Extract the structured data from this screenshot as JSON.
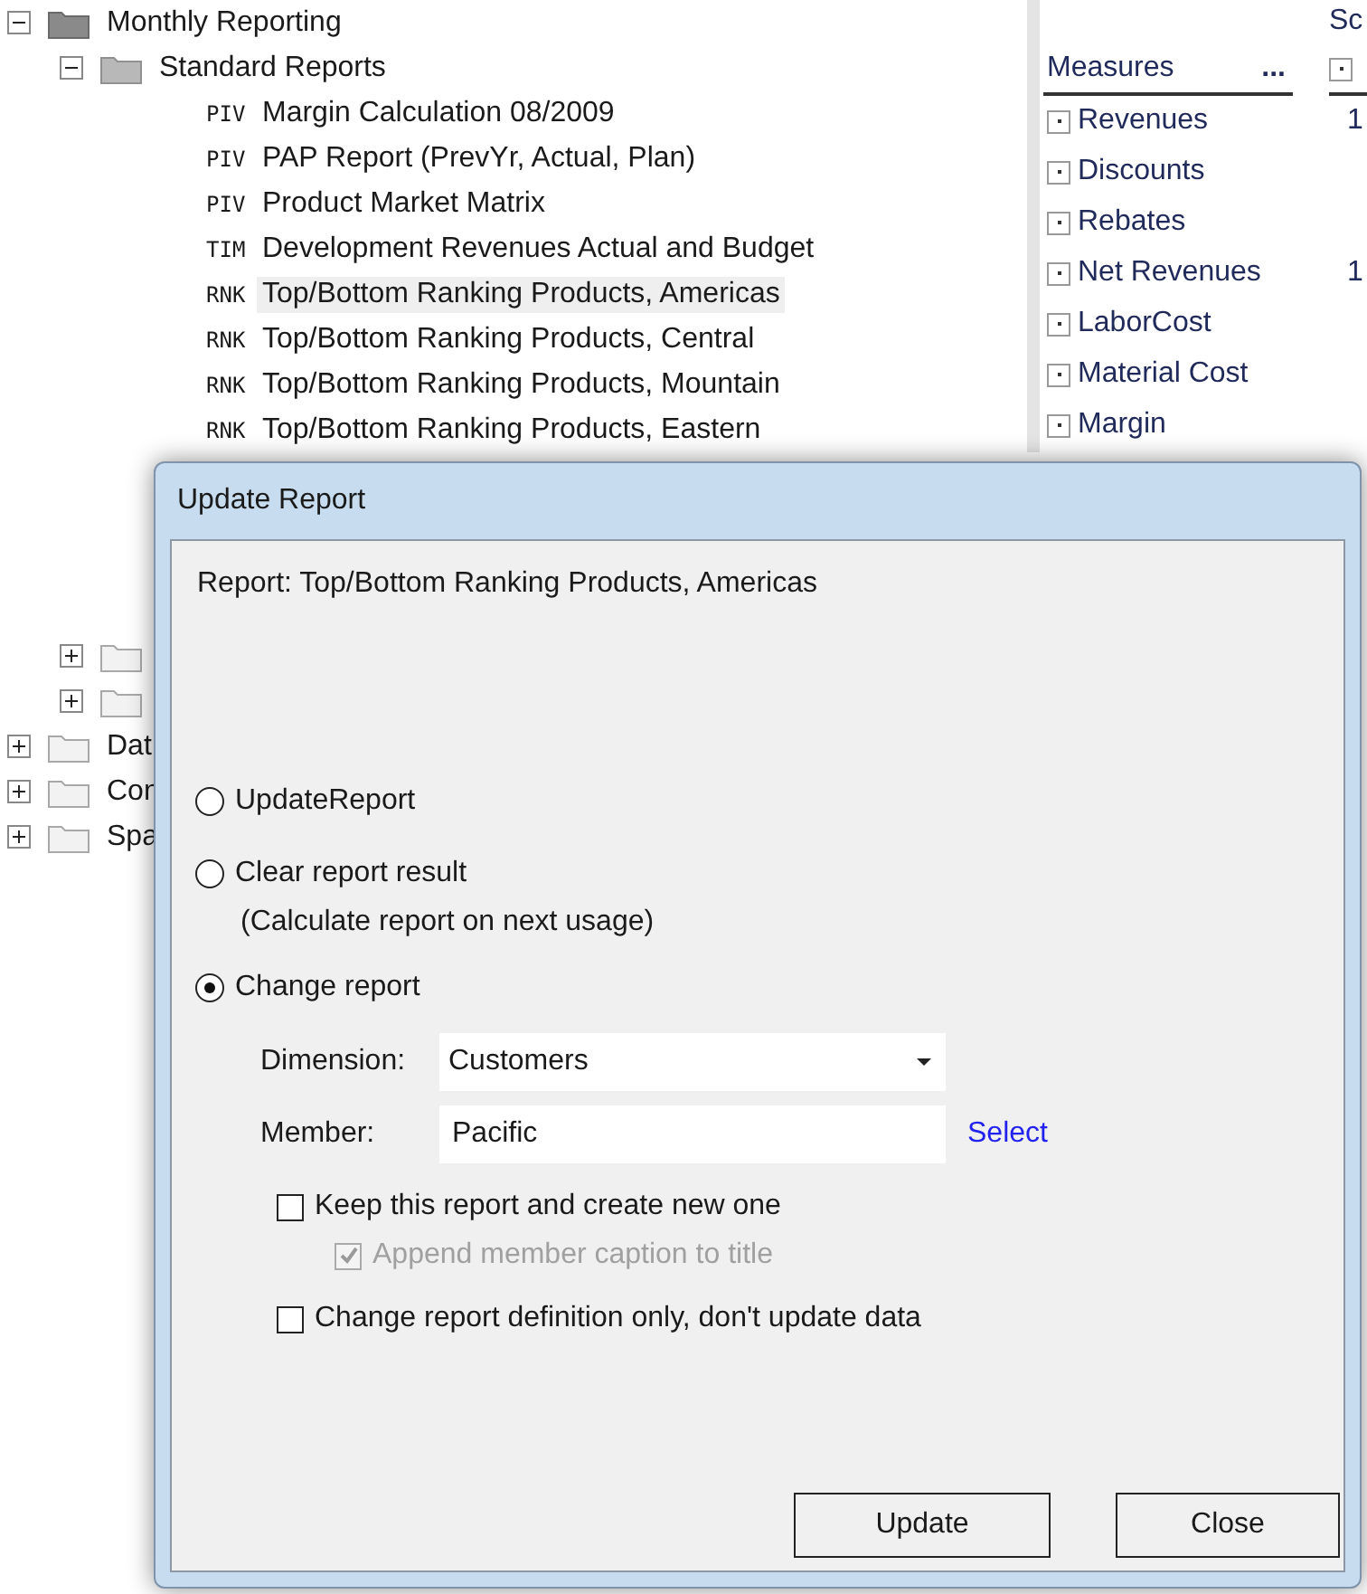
{
  "tree": [
    {
      "label": "Monthly Reporting",
      "kind": "folder",
      "expanded": true,
      "children": [
        {
          "label": "Standard Reports",
          "kind": "folder",
          "expanded": true,
          "children": [
            {
              "code": "PIV",
              "label": "Margin Calculation 08/2009",
              "kind": "report",
              "selected": false
            },
            {
              "code": "PIV",
              "label": "PAP Report (PrevYr, Actual, Plan)",
              "kind": "report",
              "selected": false
            },
            {
              "code": "PIV",
              "label": "Product Market Matrix",
              "kind": "report",
              "selected": false
            },
            {
              "code": "TIM",
              "label": "Development Revenues Actual and Budget",
              "kind": "report",
              "selected": false
            },
            {
              "code": "RNK",
              "label": "Top/Bottom Ranking Products, Americas",
              "kind": "report",
              "selected": true
            },
            {
              "code": "RNK",
              "label": "Top/Bottom Ranking Products, Central",
              "kind": "report",
              "selected": false
            },
            {
              "code": "RNK",
              "label": "Top/Bottom Ranking Products, Mountain",
              "kind": "report",
              "selected": false
            },
            {
              "code": "RNK",
              "label": "Top/Bottom Ranking Products, Eastern",
              "kind": "report",
              "selected": false
            }
          ]
        },
        {
          "kind": "folder",
          "expanded": false
        },
        {
          "kind": "folder",
          "expanded": false
        }
      ]
    },
    {
      "label": "Dat",
      "kind": "folder",
      "expanded": false
    },
    {
      "label": "Con",
      "kind": "folder",
      "expanded": false
    },
    {
      "label": "Spa",
      "kind": "folder",
      "expanded": false
    }
  ],
  "measures_panel": {
    "column_2_header": "Sc",
    "header": "Measures",
    "more": "...",
    "rows": [
      {
        "label": "Revenues",
        "value": "1"
      },
      {
        "label": "Discounts"
      },
      {
        "label": "Rebates"
      },
      {
        "label": "Net Revenues",
        "value": "1"
      },
      {
        "label": "LaborCost"
      },
      {
        "label": "Material Cost"
      },
      {
        "label": "Margin"
      }
    ]
  },
  "dialog": {
    "title": "Update Report",
    "report_line": "Report: Top/Bottom Ranking Products, Americas",
    "options": [
      {
        "label": "UpdateReport",
        "selected": false
      },
      {
        "label": "Clear report result",
        "note": "(Calculate report on next usage)",
        "selected": false
      },
      {
        "label": "Change report",
        "selected": true
      }
    ],
    "dimension": {
      "label": "Dimension:",
      "value": "Customers"
    },
    "member": {
      "label": "Member:",
      "value": "Pacific",
      "link": "Select"
    },
    "checkboxes": [
      {
        "label": "Keep this report and create new one",
        "checked": false,
        "disabled": false,
        "children": [
          {
            "label": "Append member caption to title",
            "checked": true,
            "disabled": true
          }
        ]
      },
      {
        "label": "Change report definition only, don't update data",
        "checked": false,
        "disabled": false
      }
    ],
    "buttons": [
      "Update",
      "Close"
    ]
  }
}
